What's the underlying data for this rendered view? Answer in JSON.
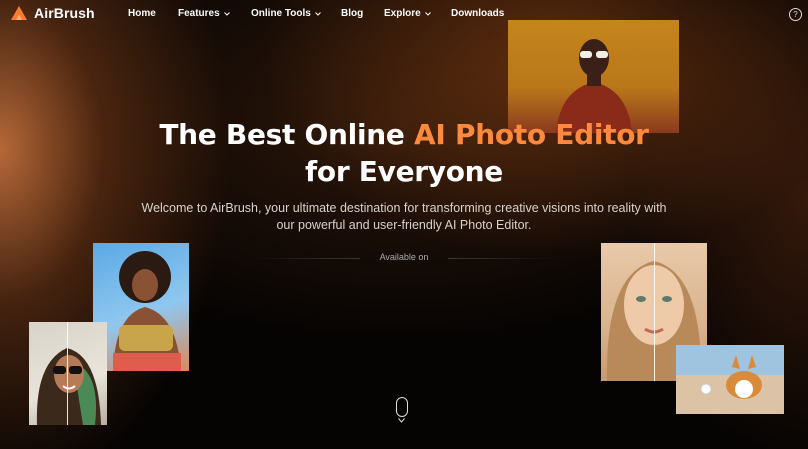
{
  "nav": {
    "logo_text": "AirBrush",
    "items": [
      {
        "label": "Home",
        "dropdown": false
      },
      {
        "label": "Features",
        "dropdown": true
      },
      {
        "label": "Online Tools",
        "dropdown": true
      },
      {
        "label": "Blog",
        "dropdown": false
      },
      {
        "label": "Explore",
        "dropdown": true
      },
      {
        "label": "Downloads",
        "dropdown": false
      }
    ],
    "help_icon": "?"
  },
  "hero": {
    "headline_part1": "The Best Online ",
    "headline_accent": "AI Photo Editor",
    "headline_line2": "for Everyone",
    "subtitle_line1": "Welcome to AirBrush, your ultimate destination for transforming creative visions into reality with",
    "subtitle_line2": "our powerful and user-friendly AI Photo Editor.",
    "available_on": "Available on"
  },
  "colors": {
    "accent": "#ff8a3d",
    "background": "#060403"
  },
  "icons": [
    "airbrush-logo-icon",
    "chevron-down-icon",
    "help-icon",
    "scroll-mouse-icon"
  ]
}
